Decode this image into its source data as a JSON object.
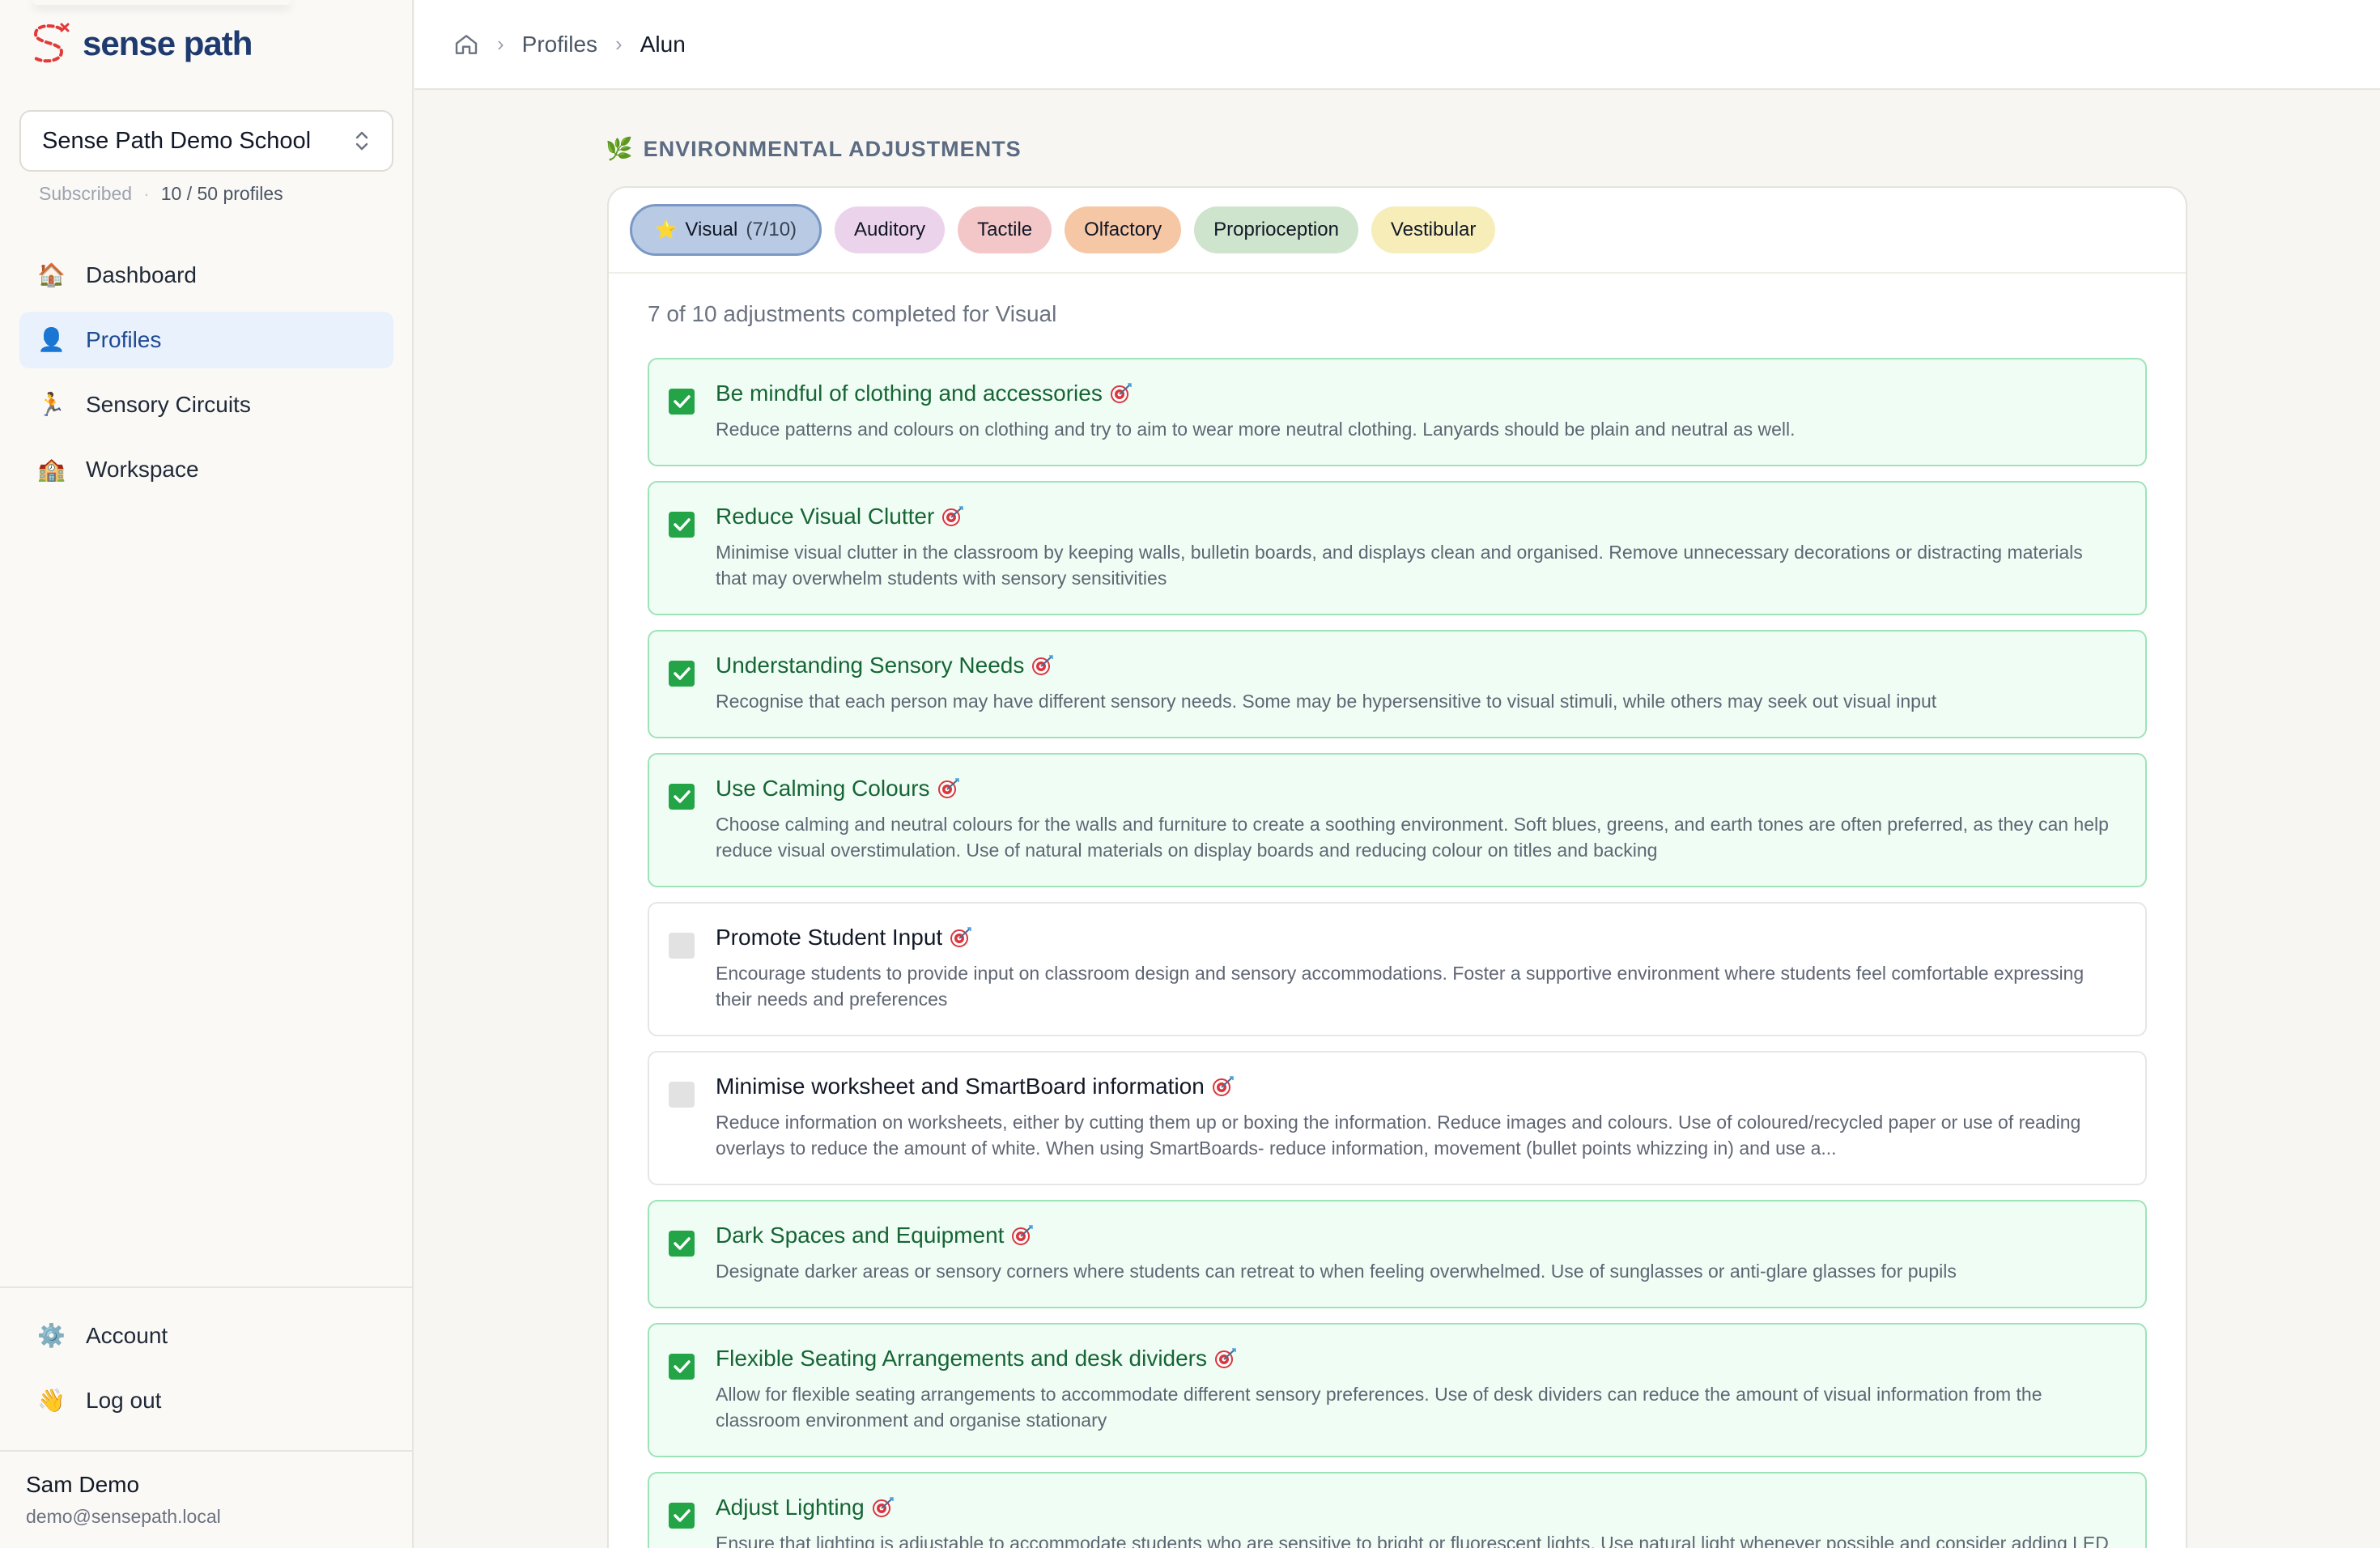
{
  "app": {
    "name": "sense path"
  },
  "sidebar": {
    "school": {
      "name": "Sense Path Demo School"
    },
    "subscription": {
      "status": "Subscribed",
      "profiles": "10 / 50 profiles"
    },
    "nav": [
      {
        "label": "Dashboard",
        "icon": "house-icon"
      },
      {
        "label": "Profiles",
        "icon": "person-icon"
      },
      {
        "label": "Sensory Circuits",
        "icon": "running-person-icon"
      },
      {
        "label": "Workspace",
        "icon": "school-building-icon"
      }
    ],
    "bottom_nav": [
      {
        "label": "Account",
        "icon": "gear-icon"
      },
      {
        "label": "Log out",
        "icon": "waving-hand-icon"
      }
    ],
    "user": {
      "name": "Sam Demo",
      "email": "demo@sensepath.local"
    }
  },
  "breadcrumb": {
    "items": [
      "Profiles",
      "Alun"
    ]
  },
  "section": {
    "title": "ENVIRONMENTAL ADJUSTMENTS"
  },
  "tabs": [
    {
      "label": "Visual",
      "count": "(7/10)"
    },
    {
      "label": "Auditory"
    },
    {
      "label": "Tactile"
    },
    {
      "label": "Olfactory"
    },
    {
      "label": "Proprioception"
    },
    {
      "label": "Vestibular"
    }
  ],
  "progress": {
    "text": "7 of 10 adjustments completed for Visual"
  },
  "adjustments": [
    {
      "title": "Be mindful of clothing and accessories",
      "completed": true,
      "desc": "Reduce patterns and colours on clothing and try to aim to wear more neutral clothing. Lanyards should be plain and neutral as well."
    },
    {
      "title": "Reduce Visual Clutter",
      "completed": true,
      "desc": "Minimise visual clutter in the classroom by keeping walls, bulletin boards, and displays clean and organised. Remove unnecessary decorations or distracting materials that may overwhelm students with sensory sensitivities"
    },
    {
      "title": "Understanding Sensory Needs",
      "completed": true,
      "desc": "Recognise that each person may have different sensory needs. Some may be hypersensitive to visual stimuli, while others may seek out visual input"
    },
    {
      "title": "Use Calming Colours",
      "completed": true,
      "desc": "Choose calming and neutral colours for the walls and furniture to create a soothing environment. Soft blues, greens, and earth tones are often preferred, as they can help reduce visual overstimulation. Use of natural materials on display boards and reducing colour on titles and backing"
    },
    {
      "title": "Promote Student Input",
      "completed": false,
      "desc": "Encourage students to provide input on classroom design and sensory accommodations. Foster a supportive environment where students feel comfortable expressing their needs and preferences"
    },
    {
      "title": "Minimise worksheet and SmartBoard information",
      "completed": false,
      "desc": "Reduce information on worksheets, either by cutting them up or boxing the information. Reduce images and colours. Use of coloured/recycled paper or use of reading overlays to reduce the amount of white. When using SmartBoards- reduce information, movement (bullet points whizzing in) and use a..."
    },
    {
      "title": "Dark Spaces and Equipment",
      "completed": true,
      "desc": "Designate darker areas or sensory corners where students can retreat to when feeling overwhelmed. Use of sunglasses or anti-glare glasses for pupils"
    },
    {
      "title": "Flexible Seating Arrangements and desk dividers",
      "completed": true,
      "desc": "Allow for flexible seating arrangements to accommodate different sensory preferences. Use of desk dividers can reduce the amount of visual information from the classroom environment and organise stationary"
    },
    {
      "title": "Adjust Lighting",
      "completed": true,
      "desc": "Ensure that lighting is adjustable to accommodate students who are sensitive to bright or fluorescent lights. Use natural light whenever possible and consider adding LED strip lights or lower lighting"
    }
  ]
}
